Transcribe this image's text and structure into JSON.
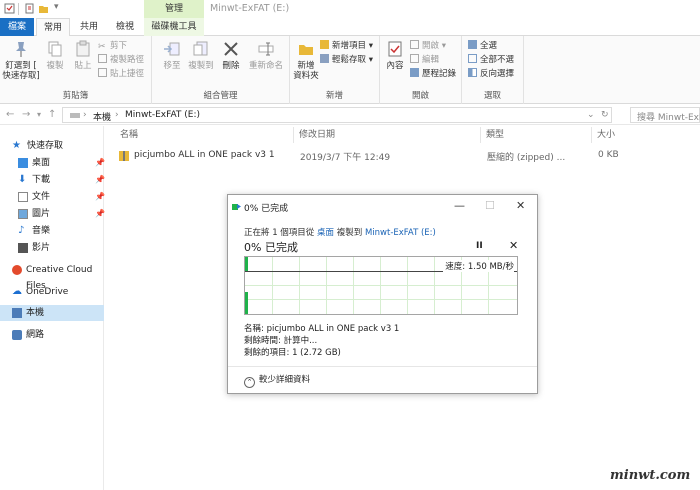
{
  "window": {
    "title": "Minwt-ExFAT (E:)",
    "manage_tab": "管理"
  },
  "tabs": [
    {
      "label": "檔案"
    },
    {
      "label": "常用"
    },
    {
      "label": "共用"
    },
    {
      "label": "檢視"
    },
    {
      "label": "磁碟機工具"
    }
  ],
  "ribbon": {
    "clipboard": {
      "label": "剪貼簿",
      "pin": "釘選到 [",
      "pin2": "快速存取]",
      "copy": "複製",
      "paste": "貼上",
      "cut": "剪下",
      "copy_path": "複製路徑",
      "paste_shortcut": "貼上捷徑"
    },
    "organize": {
      "label": "組合管理",
      "move_to": "移至",
      "copy_to": "複製到",
      "delete": "刪除",
      "rename": "重新命名"
    },
    "new": {
      "label": "新增",
      "new_folder": "新增",
      "new_folder2": "資料夾",
      "new_item": "新增項目 ▾",
      "easy_access": "輕鬆存取 ▾"
    },
    "open": {
      "label": "開啟",
      "properties": "內容",
      "open": "開啟 ▾",
      "edit": "編輯",
      "history": "歷程記錄"
    },
    "select": {
      "label": "選取",
      "select_all": "全選",
      "select_none": "全部不選",
      "invert": "反向選擇"
    }
  },
  "address": {
    "path": [
      "本機",
      "Minwt-ExFAT (E:)"
    ],
    "search_placeholder": "搜尋 Minwt-ExFAT"
  },
  "nav": {
    "quick_access": "快速存取",
    "desktop": "桌面",
    "downloads": "下載",
    "documents": "文件",
    "pictures": "圖片",
    "music": "音樂",
    "videos": "影片",
    "creative_cloud": "Creative Cloud Files",
    "onedrive": "OneDrive",
    "this_pc": "本機",
    "network": "網路"
  },
  "columns": {
    "name": "名稱",
    "date": "修改日期",
    "type": "類型",
    "size": "大小"
  },
  "files": [
    {
      "name": "picjumbo ALL in ONE pack v3 1",
      "date": "2019/3/7 下午 12:49",
      "type": "壓縮的 (zipped) ...",
      "size": "0 KB"
    }
  ],
  "dialog": {
    "title": "0% 已完成",
    "status_prefix": "正在將 1 個項目從",
    "source": "桌面",
    "status_mid": "複製到",
    "dest": "Minwt-ExFAT (E:)",
    "percent_text": "0% 已完成",
    "pause": "II",
    "speed": "速度: 1.50 MB/秒",
    "name_line": "名稱: picjumbo ALL in ONE pack v3 1",
    "time_line": "剩餘時間: 計算中...",
    "items_line": "剩餘的項目: 1 (2.72 GB)",
    "less_details": "較少詳細資料",
    "progress_percent": 0
  },
  "watermark": "minwt.com",
  "colors": {
    "file_tab": "#1a6fc4",
    "manage_tab": "#dff2c9",
    "progress": "#1fb24a",
    "selection": "#cce4f7",
    "link": "#1a63b5"
  }
}
